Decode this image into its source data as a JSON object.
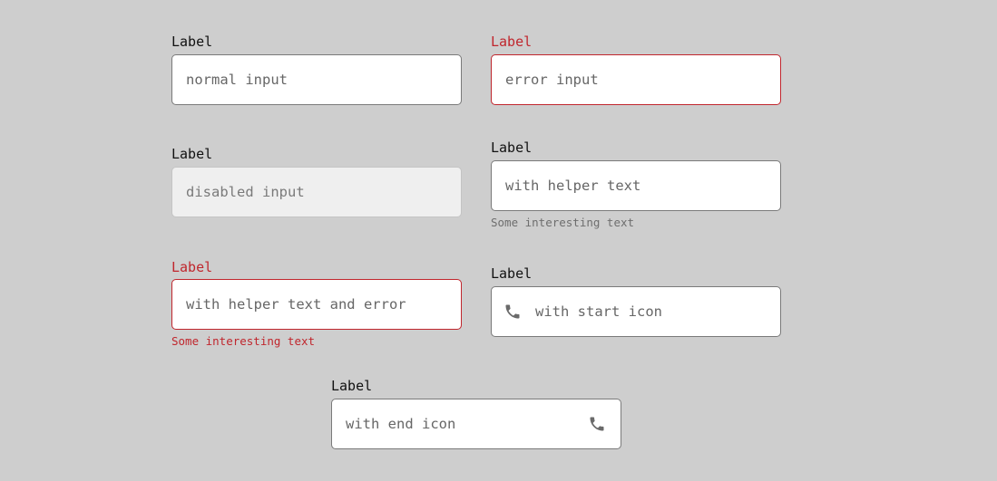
{
  "fields": {
    "normal": {
      "label": "Label",
      "placeholder": "normal input"
    },
    "error": {
      "label": "Label",
      "placeholder": "error input"
    },
    "disabled": {
      "label": "Label",
      "placeholder": "disabled input"
    },
    "helper": {
      "label": "Label",
      "placeholder": "with helper text",
      "helper": "Some interesting text"
    },
    "helper_error": {
      "label": "Label",
      "placeholder": "with helper text and error",
      "helper": "Some interesting text"
    },
    "start_icon": {
      "label": "Label",
      "placeholder": "with start icon",
      "icon": "phone-icon"
    },
    "end_icon": {
      "label": "Label",
      "placeholder": "with end icon",
      "icon": "phone-icon"
    }
  },
  "colors": {
    "background": "#cecece",
    "error": "#c0262d",
    "border": "#7a7a7a",
    "disabled_fill": "#efefef",
    "icon": "#6a6a6a"
  }
}
